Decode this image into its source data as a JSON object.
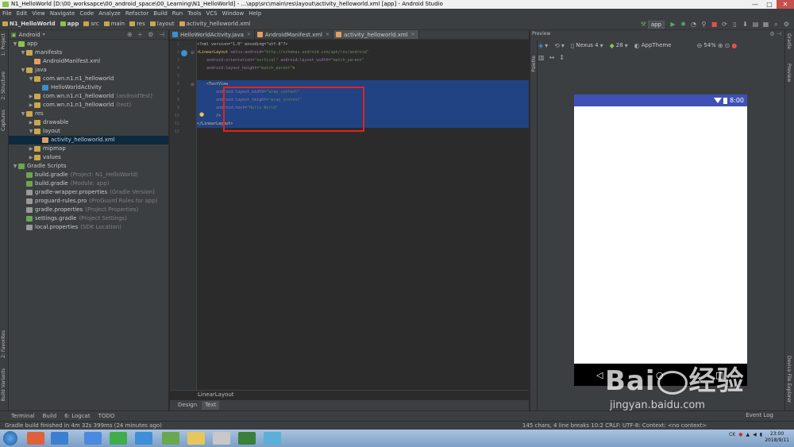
{
  "window": {
    "title": "N1_HelloWorld [D:\\00_worksapce\\00_android_space\\00_Learning\\N1_HelloWorld] - ...\\app\\src\\main\\res\\layout\\activity_helloworld.xml [app] - Android Studio",
    "min": "—",
    "max": "□",
    "close": "✕"
  },
  "menu": [
    "File",
    "Edit",
    "View",
    "Navigate",
    "Code",
    "Analyze",
    "Refactor",
    "Build",
    "Run",
    "Tools",
    "VCS",
    "Window",
    "Help"
  ],
  "breadcrumbs": [
    "N1_HelloWorld",
    "app",
    "src",
    "main",
    "res",
    "layout",
    "activity_helloworld.xml"
  ],
  "run_config": "app",
  "project_panel": {
    "view_selector": "Android",
    "tree": [
      {
        "label": "app",
        "hint": "",
        "depth": 0,
        "arrow": "▼",
        "color": "#8bc34a"
      },
      {
        "label": "manifests",
        "hint": "",
        "depth": 1,
        "arrow": "▼",
        "color": "#c9a84c"
      },
      {
        "label": "AndroidManifest.xml",
        "hint": "",
        "depth": 2,
        "arrow": "",
        "color": "#e0a060"
      },
      {
        "label": "java",
        "hint": "",
        "depth": 1,
        "arrow": "▼",
        "color": "#c9a84c"
      },
      {
        "label": "com.wn.n1.n1_helloworld",
        "hint": "",
        "depth": 2,
        "arrow": "▼",
        "color": "#c9a84c"
      },
      {
        "label": "HelloWorldActivity",
        "hint": "",
        "depth": 3,
        "arrow": "",
        "color": "#3d8fd0"
      },
      {
        "label": "com.wn.n1.n1_helloworld",
        "hint": "(androidTest)",
        "depth": 2,
        "arrow": "▶",
        "color": "#c9a84c"
      },
      {
        "label": "com.wn.n1.n1_helloworld",
        "hint": "(test)",
        "depth": 2,
        "arrow": "▶",
        "color": "#c9a84c"
      },
      {
        "label": "res",
        "hint": "",
        "depth": 1,
        "arrow": "▼",
        "color": "#c9a84c"
      },
      {
        "label": "drawable",
        "hint": "",
        "depth": 2,
        "arrow": "▶",
        "color": "#c9a84c"
      },
      {
        "label": "layout",
        "hint": "",
        "depth": 2,
        "arrow": "▼",
        "color": "#c9a84c"
      },
      {
        "label": "activity_helloworld.xml",
        "hint": "",
        "depth": 3,
        "arrow": "",
        "color": "#e0a060",
        "active": true
      },
      {
        "label": "mipmap",
        "hint": "",
        "depth": 2,
        "arrow": "▶",
        "color": "#c9a84c"
      },
      {
        "label": "values",
        "hint": "",
        "depth": 2,
        "arrow": "▶",
        "color": "#c9a84c"
      },
      {
        "label": "Gradle Scripts",
        "hint": "",
        "depth": 0,
        "arrow": "▼",
        "color": "#6aa84f"
      },
      {
        "label": "build.gradle",
        "hint": "(Project: N1_HelloWorld)",
        "depth": 1,
        "arrow": "",
        "color": "#6aa84f"
      },
      {
        "label": "build.gradle",
        "hint": "(Module: app)",
        "depth": 1,
        "arrow": "",
        "color": "#6aa84f"
      },
      {
        "label": "gradle-wrapper.properties",
        "hint": "(Gradle Version)",
        "depth": 1,
        "arrow": "",
        "color": "#999999"
      },
      {
        "label": "proguard-rules.pro",
        "hint": "(ProGuard Rules for app)",
        "depth": 1,
        "arrow": "",
        "color": "#999999"
      },
      {
        "label": "gradle.properties",
        "hint": "(Project Properties)",
        "depth": 1,
        "arrow": "",
        "color": "#999999"
      },
      {
        "label": "settings.gradle",
        "hint": "(Project Settings)",
        "depth": 1,
        "arrow": "",
        "color": "#6aa84f"
      },
      {
        "label": "local.properties",
        "hint": "(SDK Location)",
        "depth": 1,
        "arrow": "",
        "color": "#999999"
      }
    ]
  },
  "left_strip": {
    "project": "1: Project",
    "structure": "2: Structure",
    "captures": "Captures",
    "favorites": "2: Favorites",
    "build_variants": "Build Variants"
  },
  "editor": {
    "tabs": [
      {
        "label": "HelloWorldActivity.java",
        "active": false,
        "color": "#3d8fd0"
      },
      {
        "label": "AndroidManifest.xml",
        "active": false,
        "color": "#e0a060"
      },
      {
        "label": "activity_helloworld.xml",
        "active": true,
        "color": "#e0a060"
      }
    ],
    "line_numbers": [
      "1",
      "2",
      "3",
      "4",
      "5",
      "6",
      "7",
      "8",
      "9",
      "10",
      "11",
      "12"
    ],
    "code": {
      "l1": "<?xml version=\"1.0\" encoding=\"utf-8\"?>",
      "l2_tag": "<LinearLayout",
      "l2_ns": " xmlns:android=",
      "l2_val": "\"http://schemas.android.com/apk/res/android\"",
      "l3_attr": "android:orientation=",
      "l3_val": "\"vertical\"",
      "l3_attr2": " android:layout_width=",
      "l3_val2": "\"match_parent\"",
      "l4_attr": "android:layout_height=",
      "l4_val": "\"match_parent\"",
      "l4_end": ">",
      "l6_tag": "<TextView",
      "l7_attr": "android:layout_width=",
      "l7_val": "\"wrap_content\"",
      "l8_attr": "android:layout_height=",
      "l8_val": "\"wrap_content\"",
      "l9_attr": "android:text=",
      "l9_val": "\"Hello World\"",
      "l10": "/>",
      "l11": "</LinearLayout>"
    },
    "breadcrumb": "LinearLayout",
    "design_tab": "Design",
    "text_tab": "Text"
  },
  "preview": {
    "header": "Preview",
    "device": "Nexus 4",
    "api": "28",
    "theme": "AppTheme",
    "zoom": "54%",
    "status_time": "8:00",
    "palette_label": "Palette",
    "nav_back": "◁",
    "nav_home": "○",
    "nav_recent": "□"
  },
  "right_strip": {
    "gradle": "Gradle",
    "preview": "Preview",
    "device_explorer": "Device File Explorer"
  },
  "bottom_tabs": [
    "Terminal",
    "Build",
    "6: Logcat",
    "TODO"
  ],
  "event_log": "Event Log",
  "status_bar": {
    "message": "Gradle build finished in 4m 32s 399ms (24 minutes ago)",
    "right": "145 chars, 4 line breaks   10:2   CRLF: UTF-8: Context: <no context>"
  },
  "taskbar": {
    "time": "23:00",
    "date": "2018/9/11",
    "tray_lang": "CK"
  },
  "watermark": {
    "brand": "Bai",
    "brand2": "经验",
    "url": "jingyan.baidu.com"
  },
  "colors": {
    "accent": "#3f51b5",
    "selection": "#214283",
    "highlight_box": "#e0241c"
  }
}
